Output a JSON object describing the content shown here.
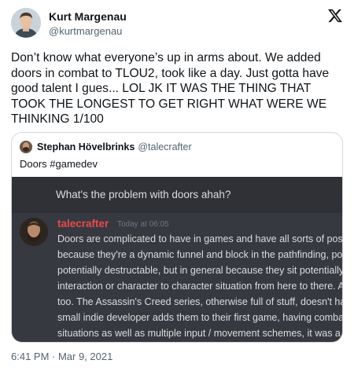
{
  "tweet": {
    "author_name": "Kurt Margenau",
    "author_handle": "@kurtmargenau",
    "text": "Don’t know what everyone’s up in arms about. We added doors in combat to TLOU2, took like a day. Just gotta have good talent I gues... LOL JK IT WAS THE THING THAT TOOK THE LONGEST TO GET RIGHT WHAT WERE WE THINKING 1/100",
    "timestamp": "6:41 PM · Mar 9, 2021"
  },
  "quote": {
    "author_name": "Stephan Hövelbrinks",
    "author_handle": "@talecrafter",
    "text": "Doors #gamedev",
    "discord": {
      "previous_message": "What's the problem with doors ahah?",
      "username": "talecrafter",
      "time": "Today at 06:05",
      "lines": [
        "Doors are complicated to have in games and have all sorts of possib",
        "because they're a dynamic funnel and block in the pathfinding, pote",
        "potentially destructable, but in general because they sit potentially",
        "interaction or character to character situation from here to there. A",
        "too. The Assassin's Creed series, otherwise full of stuff, doesn't hav",
        "small indie developer adds them to their first game, having combat",
        "situations as well as multiple input / movement schemes, it was a l"
      ]
    }
  },
  "icons": {
    "logo": "x-logo-icon"
  }
}
